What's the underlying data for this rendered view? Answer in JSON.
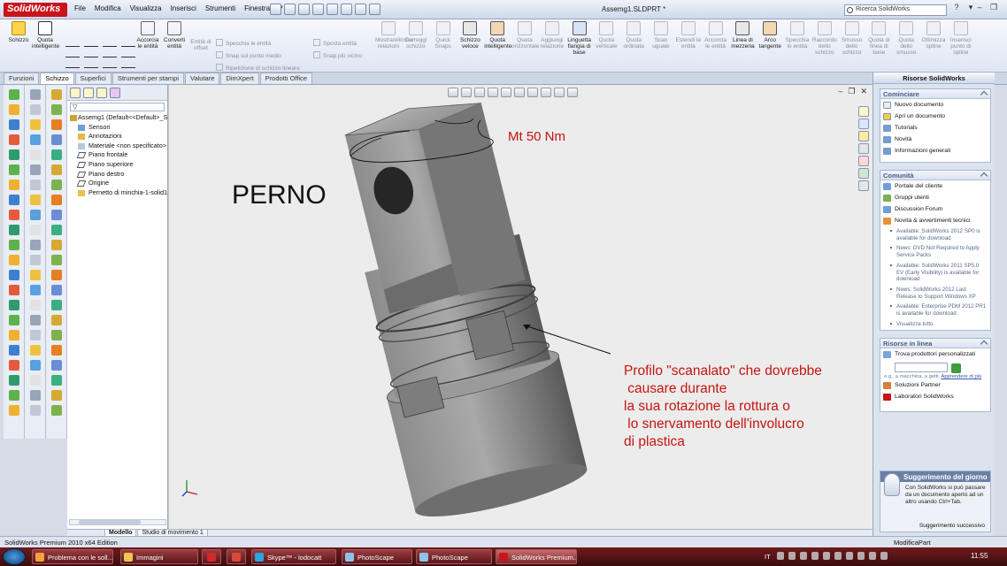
{
  "app": {
    "logo_text": "SolidWorks",
    "document_title": "Assemg1.SLDPRT *",
    "menu": [
      "File",
      "Modifica",
      "Visualizza",
      "Inserisci",
      "Strumenti",
      "Finestra",
      "?"
    ],
    "search_placeholder": "Ricerca SolidWorks",
    "help_icon": "?"
  },
  "command_manager": {
    "sketch_big": [
      {
        "label": "Schizzo",
        "icon": "sketch-icon"
      },
      {
        "label": "Quota intelligente",
        "icon": "smart-dimension-icon"
      }
    ],
    "trim_group": [
      {
        "label": "Accorcia le entità",
        "icon": "trim-icon"
      },
      {
        "label": "Converti entità",
        "icon": "convert-icon"
      },
      {
        "label": "Entità di offset",
        "icon": "offset-icon"
      }
    ],
    "small_tools": [
      {
        "label": "Specchia le entità"
      },
      {
        "label": "Snap sul punto medio"
      },
      {
        "label": "Ripetizione di schizzo lineare"
      },
      {
        "label": "Sposta entità"
      },
      {
        "label": "Snap più vicino"
      }
    ],
    "tools": [
      {
        "label": "Mostra/elimina relazioni",
        "dis": true
      },
      {
        "label": "Correggi schizzo",
        "dis": true
      },
      {
        "label": "Quick Snaps",
        "dis": true
      },
      {
        "label": "Schizzo veloce",
        "dis": false
      },
      {
        "label": "Quota intelligente",
        "dis": false
      },
      {
        "label": "Quota orizzontale",
        "dis": true
      },
      {
        "label": "Aggiungi relazione",
        "dis": true
      },
      {
        "label": "Linguetta flangia di base",
        "dis": false
      },
      {
        "label": "Quota verticale",
        "dis": true
      },
      {
        "label": "Quota ordinata",
        "dis": true
      },
      {
        "label": "Scan uguale",
        "dis": true
      },
      {
        "label": "Estendi le entità",
        "dis": true
      },
      {
        "label": "Accorcia le entità",
        "dis": true
      },
      {
        "label": "Linea di mezzeria",
        "dis": false
      },
      {
        "label": "Arco tangente",
        "dis": false
      },
      {
        "label": "Specchia le entità",
        "dis": true
      },
      {
        "label": "Raccordo dello schizzo",
        "dis": true
      },
      {
        "label": "Smusso dello schizzo",
        "dis": true
      },
      {
        "label": "Quota di linea di base",
        "dis": true
      },
      {
        "label": "Quota dello smusso",
        "dis": true
      },
      {
        "label": "Ottimizza spline",
        "dis": true
      },
      {
        "label": "Inserisci punto di spline",
        "dis": true
      }
    ]
  },
  "tabs": [
    "Funzioni",
    "Schizzo",
    "Superfici",
    "Strumenti per stampi",
    "Valutare",
    "DimXpert",
    "Prodotti Office"
  ],
  "active_tab": "Schizzo",
  "feature_tree": {
    "root": "Assemg1  (Default<<Default>_S",
    "items": [
      "Sensori",
      "Annotazioni",
      "Materiale <non specificato>",
      "Piano frontale",
      "Piano superiore",
      "Piano destro",
      "Origine",
      "Pernetto di minchia-1-solid1"
    ]
  },
  "graphics": {
    "title_note": "PERNO",
    "torque_note": "Mt 50 Nm",
    "callout_lines": [
      "Profilo \"scanalato\" che dovrebbe",
      " causare durante",
      "la sua rotazione la rottura o",
      " lo snervamento dell'involucro",
      "di plastica"
    ]
  },
  "model_tabs": [
    "Modello",
    "Studio di movimento 1"
  ],
  "task_pane": {
    "header": "Risorse SolidWorks",
    "start": {
      "title": "Cominciare",
      "items": [
        "Nuovo documento",
        "Apri un documento",
        "Tutorials",
        "Novità",
        "Informazioni generali"
      ]
    },
    "community": {
      "title": "Comunità",
      "items": [
        "Portale del cliente",
        "Gruppi utenti",
        "Discussion Forum",
        "Novità & avvertimenti tecnici"
      ],
      "news": [
        "Available: SolidWorks 2012 SP0 is available for download",
        "News: DVD Not Required to Apply Service Packs",
        "Available: SolidWorks 2011 SP5.0 EV (Early Visibility) is available for download",
        "News: SolidWorks 2012 Last Release to Support Windows XP",
        "Available: Enterprise PDM 2012 PR1 is available for download"
      ],
      "more": "Visualizza tutto"
    },
    "online": {
      "title": "Risorse in linea",
      "find": "Trova produttori personalizzati",
      "hint": "e.g., a macchina, a getti.",
      "hint_link": "Apprendere di più",
      "items": [
        "Soluzioni Partner",
        "Laboratori SolidWorks"
      ]
    },
    "tip": {
      "title": "Suggerimento del giorno",
      "text": "Con SolidWorks si può passare da un documento aperto ad un altro usando Ctrl+Tab.",
      "next": "Suggerimento successivo"
    }
  },
  "status": {
    "left": "SolidWorks Premium 2010 x64 Edition",
    "right": "ModificaPart"
  },
  "taskbar": {
    "buttons": [
      "Problema con le soll...",
      "Immagini",
      "",
      "",
      "Skype™ - lodocatt",
      "PhotoScape",
      "PhotoScape",
      "SolidWorks Premium..."
    ],
    "lang": "IT",
    "clock": "11:55"
  },
  "colors": {
    "annotation_red": "#c41510",
    "taskbar": "#5a1619",
    "brand_red": "#c8141a"
  }
}
